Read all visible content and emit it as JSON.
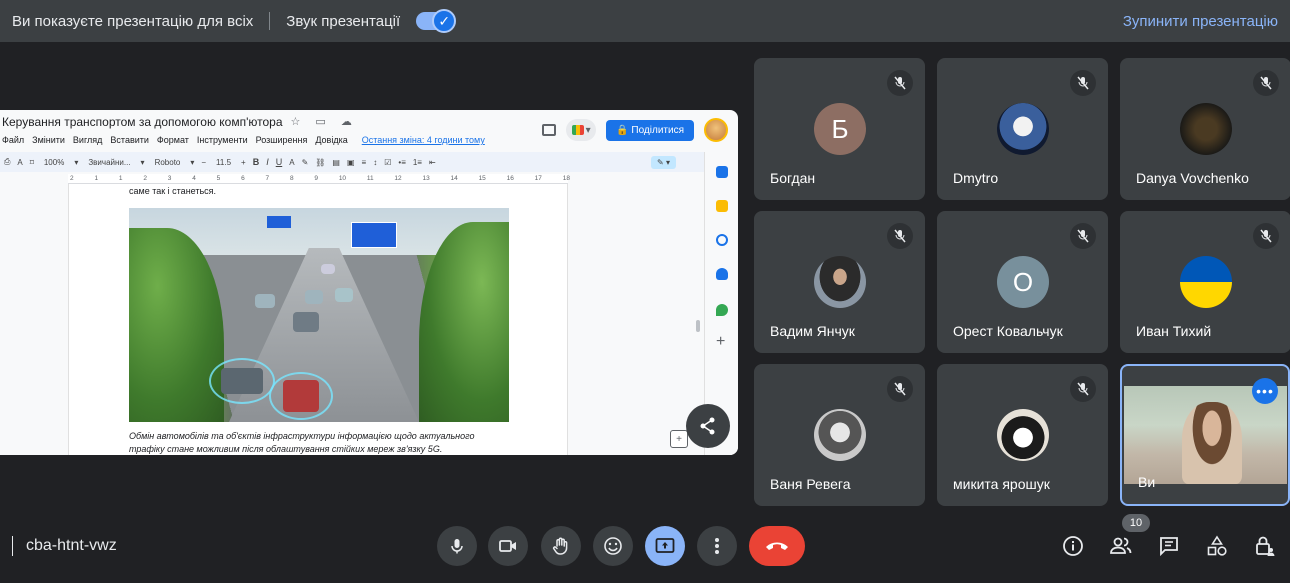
{
  "banner": {
    "presenting_text": "Ви показуєте презентацію для всіх",
    "audio_label": "Звук презентації",
    "stop_label": "Зупинити презентацію"
  },
  "doc": {
    "title": "Керування транспортом за допомогою комп'ютора",
    "menu": [
      "Файл",
      "Змінити",
      "Вигляд",
      "Вставити",
      "Формат",
      "Інструменти",
      "Розширення",
      "Довідка"
    ],
    "last_edit": "Остання зміна: 4 години тому",
    "share_label": "Поділитися",
    "toolbar": {
      "zoom": "100%",
      "style": "Звичайни...",
      "font": "Roboto",
      "size": "11.5"
    },
    "ruler_ticks": [
      "2",
      "1",
      "1",
      "2",
      "3",
      "4",
      "5",
      "6",
      "7",
      "8",
      "9",
      "10",
      "11",
      "12",
      "13",
      "14",
      "15",
      "16",
      "17",
      "18"
    ],
    "text_line": "саме так і станеться.",
    "caption": "Обмін автомобілів та об'єктів інфраструктури інформацією щодо актуального трафіку стане можливим після облаштування стійких мереж зв'язку 5G."
  },
  "participants": [
    {
      "name": "Богдан",
      "initial": "Б",
      "color": "#8d6e63"
    },
    {
      "name": "Dmytro",
      "initial": "",
      "color": "#1f2a44"
    },
    {
      "name": "Danya Vovchenko",
      "initial": "",
      "color": "#1b1a17"
    },
    {
      "name": "Вадим Янчук",
      "initial": "",
      "color": "#8a96a3"
    },
    {
      "name": "Орест Ковальчук",
      "initial": "О",
      "color": "#78909c"
    },
    {
      "name": "Иван Тихий",
      "initial": "",
      "color": "#0057b7"
    },
    {
      "name": "Ваня Ревега",
      "initial": "",
      "color": "#c9c9c9"
    },
    {
      "name": "микита ярошук",
      "initial": "",
      "color": "#e6e1d8"
    }
  ],
  "self": {
    "name": "Ви"
  },
  "participant_count": "10",
  "meeting_code": "cba-htnt-vwz",
  "colors": {
    "accent": "#8ab4f8",
    "hangup": "#ea4335",
    "tile": "#3c4043"
  }
}
